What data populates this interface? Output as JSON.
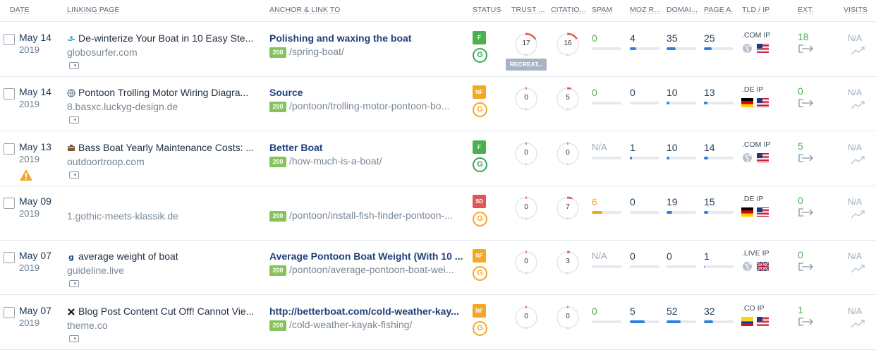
{
  "headers": {
    "date": "DATE",
    "linking_page": "LINKING PAGE",
    "anchor": "ANCHOR & LINK TO",
    "status": "STATUS",
    "trust": "TRUST ...",
    "citation": "CITATIO...",
    "spam": "SPAM",
    "moz": "MOZ R...",
    "domain": "DOMAI...",
    "page": "PAGE A.",
    "tld": "TLD / IP",
    "ext": "EXT.",
    "visits": "VISITS"
  },
  "recreate_label": "RECREAT...",
  "colors": {
    "accent": "#2f7fe0",
    "green": "#4caf50",
    "orange": "#f5a623",
    "red": "#e05555"
  },
  "rows": [
    {
      "date_md": "May 14",
      "date_y": "2019",
      "warning": false,
      "favicon": "surf-icon",
      "title": "De-winterize Your Boat in 10 Easy Ste...",
      "domain": "globosurfer.com",
      "anchor_text": "Polishing and waxing the boat",
      "http": "200",
      "url": "/spring-boat/",
      "status": "F",
      "status_color": "#4caf50",
      "g_color": "green",
      "trust": "17",
      "trust_frac": 0.17,
      "citation": "16",
      "citation_frac": 0.16,
      "recreate": true,
      "spam": "0",
      "spam_style": "green",
      "spam_frac": 0,
      "moz": "4",
      "moz_frac": 0.22,
      "domain_auth": "35",
      "domain_frac": 0.32,
      "page_auth": "25",
      "page_frac": 0.25,
      "tld": ".COM",
      "ip": "IP",
      "tld_flag": "globe",
      "ip_flag": "us",
      "ext": "18",
      "visits": "N/A"
    },
    {
      "date_md": "May 14",
      "date_y": "2019",
      "warning": false,
      "favicon": "globe-favicon-icon",
      "title": "Pontoon Trolling Motor Wiring Diagra...",
      "domain": "8.basxc.luckyg-design.de",
      "anchor_text": "Source",
      "http": "200",
      "url": "/pontoon/trolling-motor-pontoon-bo...",
      "status": "NF",
      "status_color": "#f5a623",
      "g_color": "orange",
      "trust": "0",
      "trust_frac": 0,
      "citation": "5",
      "citation_frac": 0.05,
      "recreate": false,
      "spam": "0",
      "spam_style": "green",
      "spam_frac": 0,
      "moz": "0",
      "moz_frac": 0,
      "domain_auth": "10",
      "domain_frac": 0.1,
      "page_auth": "13",
      "page_frac": 0.13,
      "tld": ".DE",
      "ip": "IP",
      "tld_flag": "de",
      "ip_flag": "us",
      "ext": "0",
      "visits": "N/A"
    },
    {
      "date_md": "May 13",
      "date_y": "2019",
      "warning": true,
      "favicon": "troop-icon",
      "title": "Bass Boat Yearly Maintenance Costs: ...",
      "domain": "outdoortroop.com",
      "anchor_text": "Better Boat",
      "http": "200",
      "url": "/how-much-is-a-boat/",
      "status": "F",
      "status_color": "#4caf50",
      "g_color": "green",
      "trust": "0",
      "trust_frac": 0,
      "citation": "0",
      "citation_frac": 0,
      "recreate": false,
      "spam": "N/A",
      "spam_style": "gray",
      "spam_frac": 0,
      "moz": "1",
      "moz_frac": 0.06,
      "domain_auth": "10",
      "domain_frac": 0.1,
      "page_auth": "14",
      "page_frac": 0.14,
      "tld": ".COM",
      "ip": "IP",
      "tld_flag": "globe",
      "ip_flag": "us",
      "ext": "5",
      "visits": "N/A"
    },
    {
      "date_md": "May 09",
      "date_y": "2019",
      "warning": false,
      "favicon": "",
      "title": "",
      "domain": "1.gothic-meets-klassik.de",
      "anchor_text": "",
      "http": "200",
      "url": "/pontoon/install-fish-finder-pontoon-...",
      "status": "SD",
      "status_color": "#e05555",
      "g_color": "orange",
      "trust": "0",
      "trust_frac": 0,
      "citation": "7",
      "citation_frac": 0.07,
      "recreate": false,
      "spam": "6",
      "spam_style": "orange",
      "spam_frac": 0.35,
      "moz": "0",
      "moz_frac": 0,
      "domain_auth": "19",
      "domain_frac": 0.19,
      "page_auth": "15",
      "page_frac": 0.15,
      "tld": ".DE",
      "ip": "IP",
      "tld_flag": "de",
      "ip_flag": "us",
      "ext": "0",
      "visits": "N/A"
    },
    {
      "date_md": "May 07",
      "date_y": "2019",
      "warning": false,
      "favicon": "g-favicon-icon",
      "title": "average weight of boat",
      "domain": "guideline.live",
      "anchor_text": "Average Pontoon Boat Weight (With 10 ...",
      "http": "200",
      "url": "/pontoon/average-pontoon-boat-wei...",
      "status": "NF",
      "status_color": "#f5a623",
      "g_color": "orange",
      "trust": "0",
      "trust_frac": 0,
      "citation": "3",
      "citation_frac": 0.03,
      "recreate": false,
      "spam": "N/A",
      "spam_style": "gray",
      "spam_frac": 0,
      "moz": "0",
      "moz_frac": 0,
      "domain_auth": "0",
      "domain_frac": 0,
      "page_auth": "1",
      "page_frac": 0.01,
      "tld": ".LIVE",
      "ip": "IP",
      "tld_flag": "globe",
      "ip_flag": "uk",
      "ext": "0",
      "visits": "N/A"
    },
    {
      "date_md": "May 07",
      "date_y": "2019",
      "warning": false,
      "favicon": "x-favicon-icon",
      "title": "Blog Post Content Cut Off! Cannot Vie...",
      "domain": "theme.co",
      "anchor_text": "http://betterboat.com/cold-weather-kay...",
      "http": "200",
      "url": "/cold-weather-kayak-fishing/",
      "status": "NF",
      "status_color": "#f5a623",
      "g_color": "orange",
      "trust": "0",
      "trust_frac": 0,
      "citation": "0",
      "citation_frac": 0,
      "recreate": false,
      "spam": "0",
      "spam_style": "green",
      "spam_frac": 0,
      "moz": "5",
      "moz_frac": 0.5,
      "domain_auth": "52",
      "domain_frac": 0.48,
      "page_auth": "32",
      "page_frac": 0.32,
      "tld": ".CO",
      "ip": "IP",
      "tld_flag": "co",
      "ip_flag": "us",
      "ext": "1",
      "visits": "N/A"
    }
  ]
}
